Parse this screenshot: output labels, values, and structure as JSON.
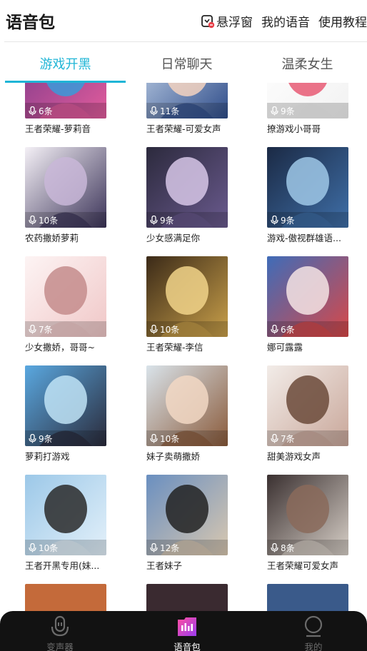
{
  "header": {
    "title": "语音包",
    "float_window": "悬浮窗",
    "my_voice": "我的语音",
    "tutorial": "使用教程"
  },
  "tabs": [
    {
      "label": "游戏开黑",
      "active": true
    },
    {
      "label": "日常聊天",
      "active": false
    },
    {
      "label": "温柔女生",
      "active": false
    }
  ],
  "accent_color": "#1fb5d6",
  "cards": [
    {
      "name": "王者荣耀-萝莉音",
      "count": "6条",
      "icon": "anime-girl-pink-art"
    },
    {
      "name": "王者荣耀-可爱女声",
      "count": "11条",
      "icon": "anime-girl-phone-art"
    },
    {
      "name": "撩游戏小哥哥",
      "count": "9条",
      "icon": "cute-face-sticker-art"
    },
    {
      "name": "农药撒娇萝莉",
      "count": "10条",
      "icon": "anime-girl-purple-hair-art"
    },
    {
      "name": "少女感满足你",
      "count": "9条",
      "icon": "anime-girl-dark-hair-art"
    },
    {
      "name": "游戏-傲视群雄语...",
      "count": "9条",
      "icon": "battle-scene-art"
    },
    {
      "name": "少女撒娇，哥哥~",
      "count": "7条",
      "icon": "sketch-girl-art"
    },
    {
      "name": "王者荣耀-李信",
      "count": "10条",
      "icon": "blonde-hero-art"
    },
    {
      "name": "娜可露露",
      "count": "6条",
      "icon": "nakoruru-art"
    },
    {
      "name": "萝莉打游戏",
      "count": "9条",
      "icon": "anime-girl-wink-art"
    },
    {
      "name": "妹子卖萌撒娇",
      "count": "10条",
      "icon": "anime-girl-brown-hair-art"
    },
    {
      "name": "甜美游戏女声",
      "count": "7条",
      "icon": "photo-girl-smile-art"
    },
    {
      "name": "王者开黑专用(妹...",
      "count": "10条",
      "icon": "photo-girl-sky-art"
    },
    {
      "name": "王者妹子",
      "count": "12条",
      "icon": "photo-girl-beach-art"
    },
    {
      "name": "王者荣耀可爱女声",
      "count": "8条",
      "icon": "photo-girl-cat-art"
    }
  ],
  "bottom_nav": [
    {
      "label": "变声器",
      "icon": "microphone-icon",
      "active": false
    },
    {
      "label": "语音包",
      "icon": "voice-pack-icon",
      "active": true
    },
    {
      "label": "我的",
      "icon": "profile-icon",
      "active": false
    }
  ]
}
